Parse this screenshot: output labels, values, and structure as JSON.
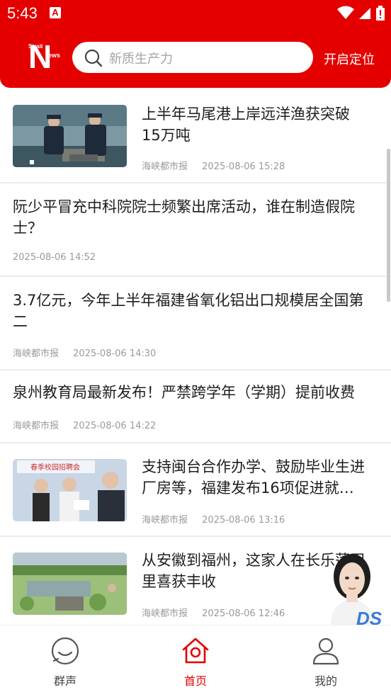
{
  "status_bar": {
    "time": "5:43"
  },
  "header": {
    "logo_text": {
      "big": "N",
      "small_top": "Strait",
      "small_right": "ews"
    },
    "search_placeholder": "新质生产力",
    "locate_label": "开启定位"
  },
  "news": [
    {
      "title": "上半年马尾港上岸远洋渔获突破15万吨",
      "source": "海峡都市报",
      "time": "2025-08-06 15:28",
      "has_image": true,
      "image": "customs-officers-inspecting-fish"
    },
    {
      "title": "阮少平冒充中科院院士频繁出席活动，谁在制造假院士？",
      "source": "",
      "time": "2025-08-06 14:52",
      "has_image": false
    },
    {
      "title": "3.7亿元，今年上半年福建省氧化铝出口规模居全国第二",
      "source": "海峡都市报",
      "time": "2025-08-06 14:30",
      "has_image": false
    },
    {
      "title": "泉州教育局最新发布！严禁跨学年（学期）提前收费",
      "source": "海峡都市报",
      "time": "2025-08-06 14:22",
      "has_image": false
    },
    {
      "title": "支持闽台合作办学、鼓励毕业生进厂房等，福建发布16项促进就…",
      "source": "海峡都市报",
      "time": "2025-08-06 13:16",
      "has_image": true,
      "image": "campus-job-fair",
      "image_caption": "春季校园招聘会"
    },
    {
      "title": "从安徽到福州，这家人在长乐莲田里喜获丰收",
      "source": "海峡都市报",
      "time": "2025-08-06 12:46",
      "has_image": true,
      "image": "lotus-field-harvest"
    }
  ],
  "tabs": [
    {
      "label": "群声",
      "icon": "chat-bubble-icon",
      "active": false
    },
    {
      "label": "首页",
      "icon": "home-icon",
      "active": true
    },
    {
      "label": "我的",
      "icon": "user-icon",
      "active": false
    }
  ],
  "ai_avatar_badge": "DS",
  "colors": {
    "brand_red": "#e50000",
    "text": "#1e1e1e",
    "meta": "#9a9a9a"
  }
}
